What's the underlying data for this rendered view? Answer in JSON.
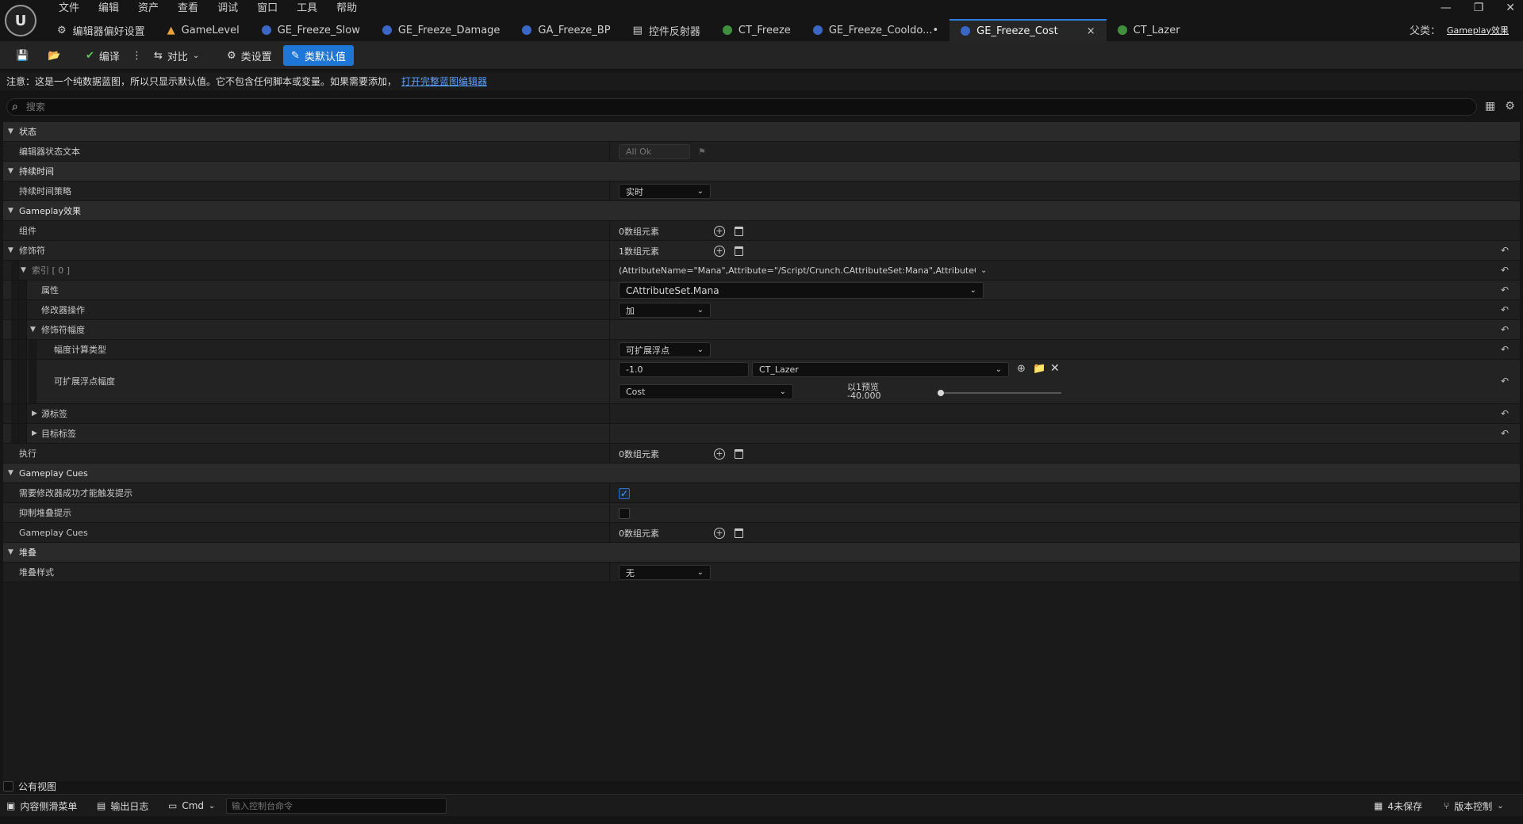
{
  "logo": "U",
  "menu": [
    "文件",
    "编辑",
    "资产",
    "查看",
    "调试",
    "窗口",
    "工具",
    "帮助"
  ],
  "window_controls": {
    "minimize": "—",
    "restore": "❐",
    "close": "✕"
  },
  "tabs": [
    {
      "label": "编辑器偏好设置"
    },
    {
      "label": "GameLevel"
    },
    {
      "label": "GE_Freeze_Slow"
    },
    {
      "label": "GE_Freeze_Damage"
    },
    {
      "label": "GA_Freeze_BP"
    },
    {
      "label": "控件反射器"
    },
    {
      "label": "CT_Freeze"
    },
    {
      "label": "GE_Freeze_Cooldo...•"
    },
    {
      "label": "GE_Freeze_Cost",
      "close": "×"
    },
    {
      "label": "CT_Lazer"
    }
  ],
  "parent_class": {
    "label": "父类：",
    "value": "Gameplay效果"
  },
  "toolbar": {
    "compile": "编译",
    "diff": "对比",
    "class_settings": "类设置",
    "class_defaults": "类默认值"
  },
  "notice": {
    "text": "注意：这是一个纯数据蓝图，所以只显示默认值。它不包含任何脚本或变量。如果需要添加，",
    "link": "打开完整蓝图编辑器"
  },
  "search": {
    "placeholder": "搜索"
  },
  "details": {
    "cat_status": "状态",
    "editor_status_text": "编辑器状态文本",
    "all_ok": "All Ok",
    "cat_duration": "持续时间",
    "duration_policy": "持续时间策略",
    "duration_policy_value": "实时",
    "cat_gameplay_effect": "Gameplay效果",
    "components": "组件",
    "components_value": "0数组元素",
    "modifiers": "修饰符",
    "modifiers_value": "1数组元素",
    "index0": "索引 [ 0 ]",
    "index0_value": "(AttributeName=\"Mana\",Attribute=\"/Script/Crunch.CAttributeSet:Mana\",AttributeOwner=\"/Scri",
    "attribute": "属性",
    "attribute_value": "CAttributeSet.Mana",
    "modifier_op": "修改器操作",
    "modifier_op_value": "加",
    "modifier_magnitude": "修饰符幅度",
    "magnitude_calc_type": "幅度计算类型",
    "magnitude_calc_type_value": "可扩展浮点",
    "scalable_float_magnitude": "可扩展浮点幅度",
    "scalable_value": "-1.0",
    "curve_table": "CT_Lazer",
    "curve_row": "Cost",
    "preview_label": "以1预览",
    "preview_value": "-40.000",
    "preview_slider_fraction": 0.0,
    "source_tags": "源标签",
    "target_tags": "目标标签",
    "executions": "执行",
    "executions_value": "0数组元素",
    "cat_gameplay_cues": "Gameplay Cues",
    "require_modifier_success": "需要修改器成功才能触发提示",
    "require_modifier_success_checked": true,
    "suppress_stacking_cues": "抑制堆叠提示",
    "suppress_stacking_cues_checked": false,
    "gameplay_cues": "Gameplay Cues",
    "gameplay_cues_value": "0数组元素",
    "cat_stacking": "堆叠",
    "stacking_type": "堆叠样式",
    "stacking_type_value": "无"
  },
  "public_view": "公有视图",
  "statusbar": {
    "content_drawer": "内容侧滑菜单",
    "output_log": "输出日志",
    "cmd": "Cmd",
    "cmd_placeholder": "输入控制台命令",
    "unsaved": "4未保存",
    "source_control": "版本控制"
  }
}
